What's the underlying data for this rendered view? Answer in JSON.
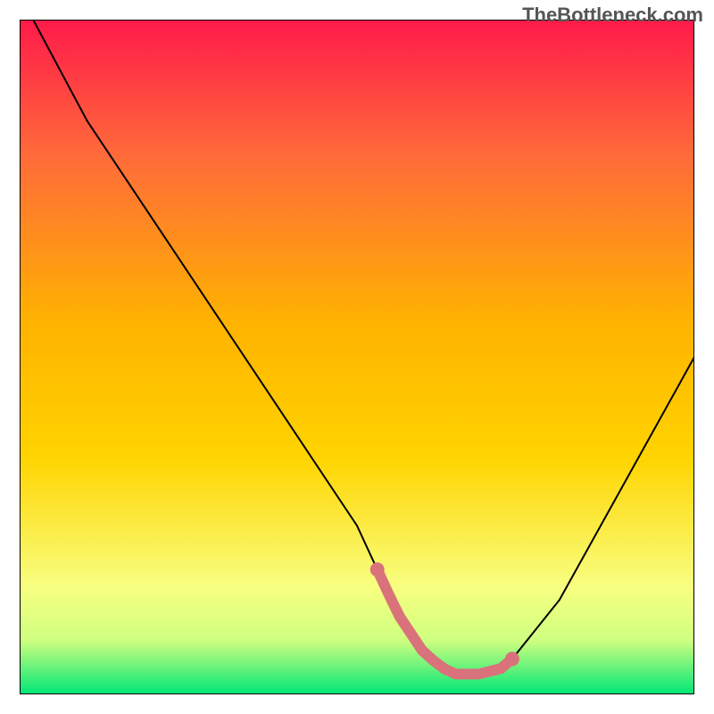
{
  "watermark": "TheBottleneck.com",
  "colors": {
    "gradient_top": "#ff1a4a",
    "gradient_mid": "#ffd400",
    "gradient_low": "#f8ff80",
    "gradient_bottom": "#00e676",
    "curve": "#000000",
    "border": "#000000",
    "highlight": "#d9727b"
  },
  "chart_data": {
    "type": "line",
    "title": "",
    "xlabel": "",
    "ylabel": "",
    "xlim": [
      0,
      100
    ],
    "ylim": [
      0,
      100
    ],
    "grid": false,
    "legend": false,
    "series": [
      {
        "name": "bottleneck-curve",
        "x": [
          2,
          10,
          20,
          30,
          40,
          50,
          56,
          60,
          64,
          68,
          72,
          80,
          90,
          100
        ],
        "y": [
          100,
          85,
          70,
          55,
          40,
          25,
          12,
          6,
          3,
          3,
          4,
          14,
          32,
          50
        ]
      }
    ],
    "highlight_region": {
      "name": "optimal-range",
      "x": [
        53,
        73
      ],
      "y_approx": 3
    }
  }
}
